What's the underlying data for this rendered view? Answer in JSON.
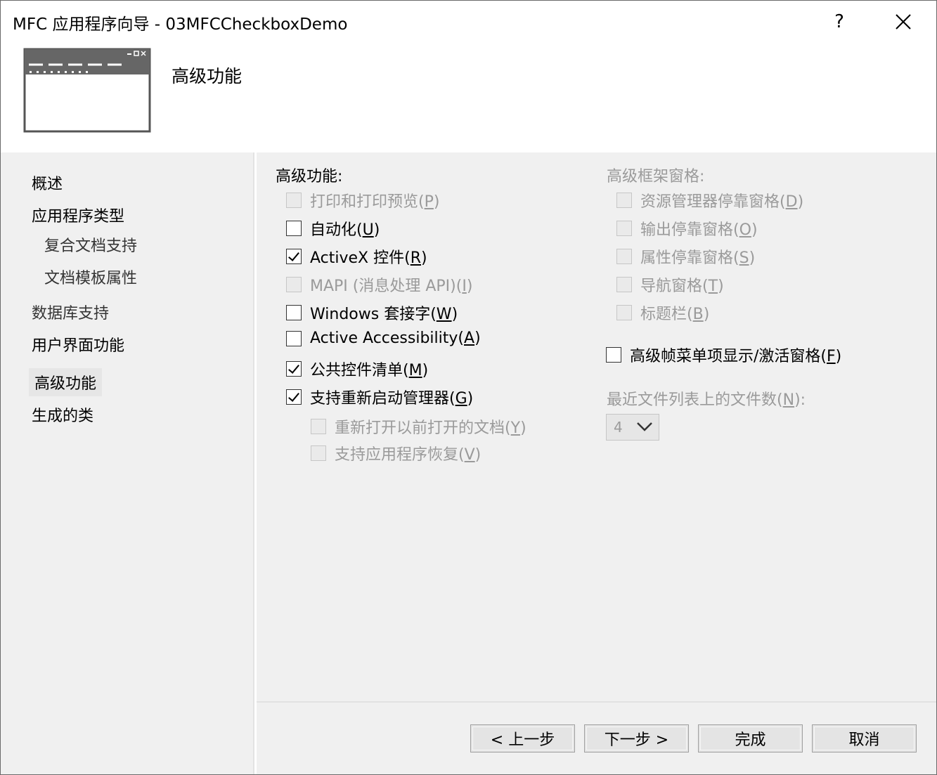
{
  "window": {
    "title": "MFC 应用程序向导 - 03MFCCheckboxDemo",
    "help_label": "?",
    "close_icon": "close-icon"
  },
  "header": {
    "title": "高级功能",
    "icon": "app-window-icon"
  },
  "sidebar": {
    "items": [
      {
        "label": "概述"
      },
      {
        "label": "应用程序类型"
      },
      {
        "label": "复合文档支持"
      },
      {
        "label": "文档模板属性"
      },
      {
        "label": "数据库支持"
      },
      {
        "label": "用户界面功能"
      },
      {
        "label": "高级功能",
        "selected": true
      },
      {
        "label": "生成的类"
      }
    ]
  },
  "advanced": {
    "label": "高级功能:",
    "items": [
      {
        "text": "打印和打印预览",
        "key": "P",
        "checked": false,
        "enabled": false
      },
      {
        "text": "自动化",
        "key": "U",
        "checked": false,
        "enabled": true
      },
      {
        "text": "ActiveX 控件",
        "key": "R",
        "checked": true,
        "enabled": true
      },
      {
        "text": "MAPI (消息处理 API)",
        "key": "I",
        "checked": false,
        "enabled": false
      },
      {
        "text": "Windows 套接字",
        "key": "W",
        "checked": false,
        "enabled": true
      },
      {
        "text": "Active Accessibility",
        "key": "A",
        "checked": false,
        "enabled": true
      },
      {
        "text": "公共控件清单",
        "key": "M",
        "checked": true,
        "enabled": true
      },
      {
        "text": "支持重新启动管理器",
        "key": "G",
        "checked": true,
        "enabled": true
      },
      {
        "text": "重新打开以前打开的文档",
        "key": "Y",
        "checked": false,
        "enabled": false
      },
      {
        "text": "支持应用程序恢复",
        "key": "V",
        "checked": false,
        "enabled": false
      }
    ]
  },
  "frame_panes": {
    "label": "高级框架窗格:",
    "items": [
      {
        "text": "资源管理器停靠窗格",
        "key": "D",
        "checked": false,
        "enabled": false
      },
      {
        "text": "输出停靠窗格",
        "key": "O",
        "checked": false,
        "enabled": false
      },
      {
        "text": "属性停靠窗格",
        "key": "S",
        "checked": false,
        "enabled": false
      },
      {
        "text": "导航窗格",
        "key": "T",
        "checked": false,
        "enabled": false
      },
      {
        "text": "标题栏",
        "key": "B",
        "checked": false,
        "enabled": false
      }
    ],
    "menu_toggle": {
      "text": "高级帧菜单项显示/激活窗格",
      "key": "F",
      "checked": false,
      "enabled": true
    }
  },
  "recent_files": {
    "label": "最近文件列表上的文件数",
    "key": "N",
    "suffix": ":",
    "value": "4",
    "enabled": false
  },
  "buttons": {
    "back": "< 上一步",
    "next": "下一步 >",
    "finish": "完成",
    "cancel": "取消"
  }
}
